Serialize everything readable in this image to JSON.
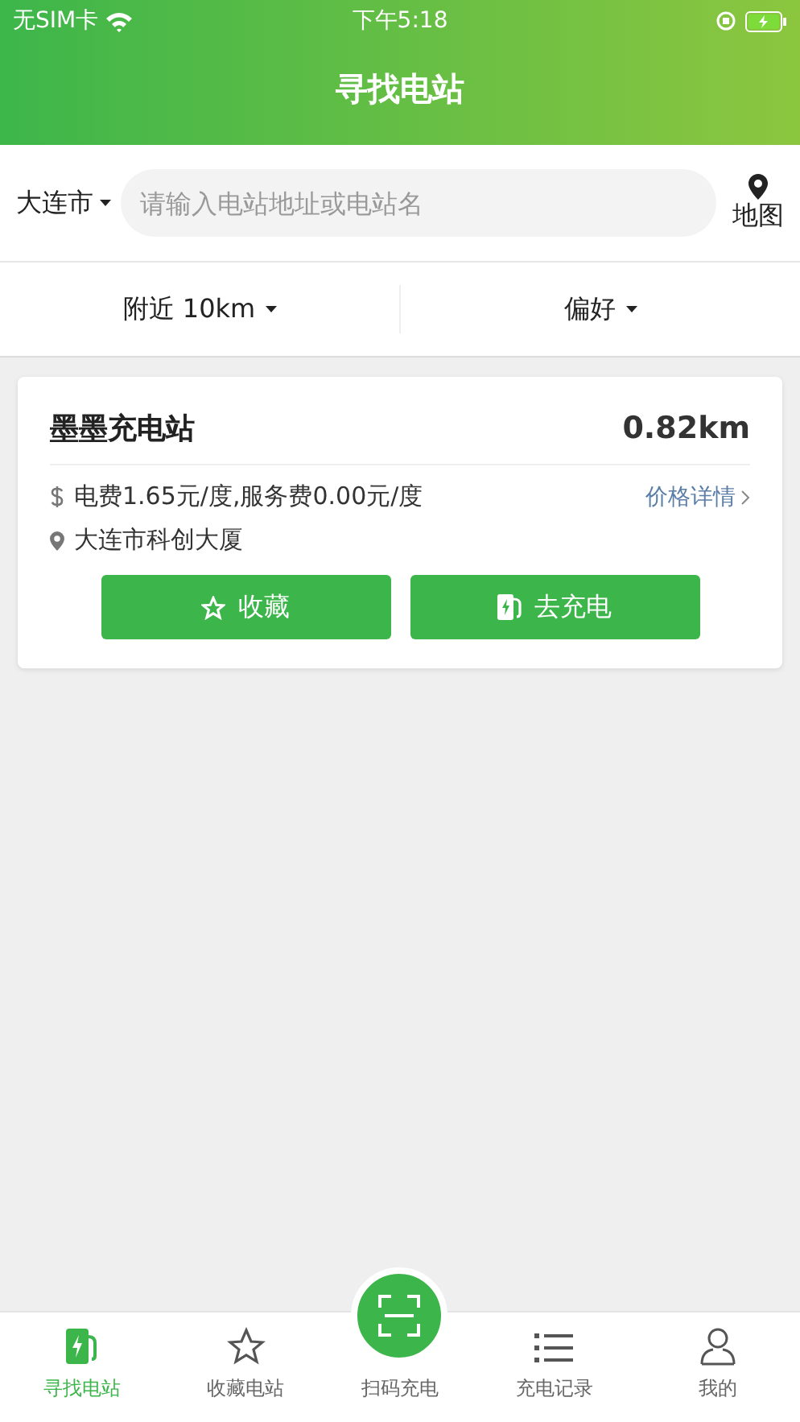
{
  "status_bar": {
    "carrier": "无SIM卡",
    "time": "下午5:18"
  },
  "header": {
    "title": "寻找电站"
  },
  "search": {
    "city": "大连市",
    "placeholder": "请输入电站地址或电站名",
    "map_label": "地图"
  },
  "filters": [
    {
      "label": "附近 10km"
    },
    {
      "label": "偏好"
    }
  ],
  "stations": [
    {
      "name": "墨墨充电站",
      "distance": "0.82km",
      "price": "电费1.65元/度,服务费0.00元/度",
      "price_link": "价格详情",
      "address": "大连市科创大厦",
      "buttons": [
        "收藏",
        "去充电"
      ]
    }
  ],
  "tab_bar": [
    {
      "label": "寻找电站",
      "kind": "tab",
      "selected": true
    },
    {
      "label": "收藏电站",
      "kind": "tab",
      "selected": false
    },
    {
      "label": "扫码充电",
      "kind": "scan",
      "selected": false
    },
    {
      "label": "充电记录",
      "kind": "tab",
      "selected": false
    },
    {
      "label": "我的",
      "kind": "tab",
      "selected": false
    }
  ]
}
